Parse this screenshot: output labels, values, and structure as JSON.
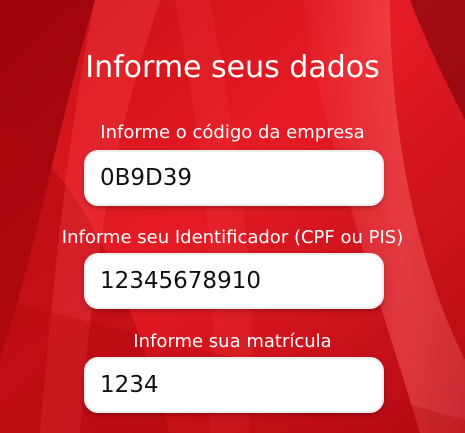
{
  "theme": {
    "background_primary": "#d5121b",
    "background_dark": "#7d0004",
    "background_light": "#ff5a5f",
    "text_on_background": "#ffffff",
    "field_background": "#ffffff",
    "field_text": "#111111"
  },
  "form": {
    "title": "Informe seus dados",
    "company_code": {
      "label": "Informe o código da empresa",
      "value": "0B9D39"
    },
    "identifier": {
      "label": "Informe seu Identificador (CPF ou PIS)",
      "value": "12345678910"
    },
    "registration": {
      "label": "Informe sua matrícula",
      "value": "1234"
    }
  }
}
